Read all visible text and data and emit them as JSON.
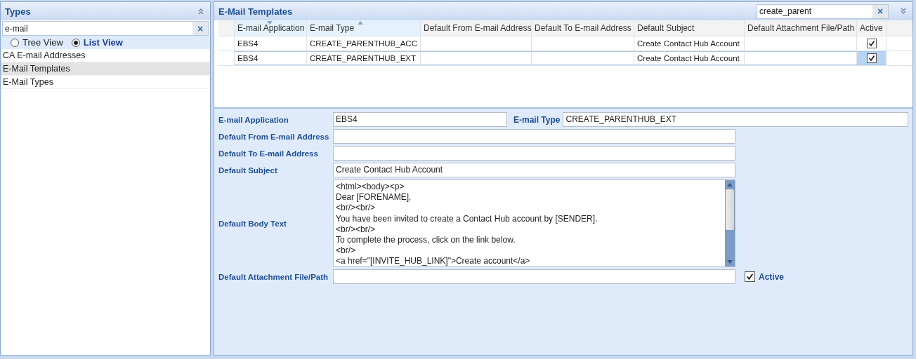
{
  "types_panel": {
    "title": "Types",
    "search": {
      "value": "e-mail",
      "clear": "×"
    },
    "views": [
      {
        "label": "Tree View",
        "selected": false
      },
      {
        "label": "List View",
        "selected": true
      }
    ],
    "items": [
      {
        "label": "CA E-mail Addresses",
        "selected": false
      },
      {
        "label": "E-Mail Templates",
        "selected": true
      },
      {
        "label": "E-Mail Types",
        "selected": false
      }
    ]
  },
  "templates_panel": {
    "title": "E-Mail Templates",
    "search": {
      "value": "create_parent",
      "clear": "×"
    },
    "table": {
      "columns": [
        {
          "label": "E-mail Application",
          "sorted_down": true,
          "sorted_up": false
        },
        {
          "label": "E-mail Type",
          "sorted_down": false,
          "sorted_up": true
        },
        {
          "label": "Default From E-mail Address",
          "sorted_down": false,
          "sorted_up": false
        },
        {
          "label": "Default To E-mail Address",
          "sorted_down": false,
          "sorted_up": false
        },
        {
          "label": "Default Subject",
          "sorted_down": false,
          "sorted_up": false
        },
        {
          "label": "Default Attachment File/Path",
          "sorted_down": false,
          "sorted_up": false
        },
        {
          "label": "Active",
          "sorted_down": false,
          "sorted_up": false
        }
      ],
      "rows": [
        {
          "selected": false,
          "application": "EBS4",
          "type": "CREATE_PARENTHUB_ACC",
          "subject": "Create Contact Hub Account",
          "active": true
        },
        {
          "selected": true,
          "application": "EBS4",
          "type": "CREATE_PARENTHUB_EXT",
          "subject": "Create Contact Hub Account",
          "active": true
        }
      ]
    },
    "form": {
      "application": {
        "label": "E-mail Application",
        "value": "EBS4"
      },
      "type": {
        "label": "E-mail Type",
        "value": "CREATE_PARENTHUB_EXT"
      },
      "from": {
        "label": "Default From E-mail Address"
      },
      "to": {
        "label": "Default To E-mail Address"
      },
      "subject": {
        "label": "Default Subject",
        "value": "Create Contact Hub Account"
      },
      "body": {
        "label": "Default Body Text",
        "lines": [
          "<html><body><p>",
          "Dear [FORENAME],",
          "<br/><br/>",
          "You have been invited to create a Contact Hub account by [SENDER].",
          "<br/><br/>",
          "To complete the process, click on the link below.",
          "<br/>",
          "<a href=\"[INVITE_HUB_LINK]\">Create account</a>"
        ]
      },
      "attachment": {
        "label": "Default Attachment File/Path"
      },
      "active": {
        "label": "Active",
        "checked": true
      }
    }
  }
}
